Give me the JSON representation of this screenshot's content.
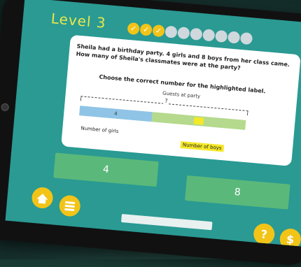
{
  "header": {
    "level_label": "Level 3",
    "progress": {
      "total": 10,
      "completed": 3
    }
  },
  "card": {
    "question": "Sheila had a birthday party. 4 girls and 8 boys from her class came. How many of Sheila's classmates were at the party?",
    "instruction": "Choose the correct number for the highlighted label.",
    "diagram": {
      "title": "Guests at party",
      "total_label": "?",
      "girls_value": "4",
      "girls_label": "Number of girls",
      "boys_label": "Number of boys"
    }
  },
  "answers": [
    {
      "label": "4"
    },
    {
      "label": "8"
    }
  ],
  "buttons": {
    "help_label": "?",
    "coin_label": "$"
  },
  "icons": {
    "home": "home-icon",
    "menu": "list-icon",
    "check": "check-icon"
  },
  "colors": {
    "screen_bg": "#2a9a93",
    "accent": "#f2c418",
    "answer_bg": "#5ab87a",
    "girls_segment": "#8fc4e6",
    "boys_segment": "#b5d98d",
    "highlight": "#f5e82a"
  }
}
